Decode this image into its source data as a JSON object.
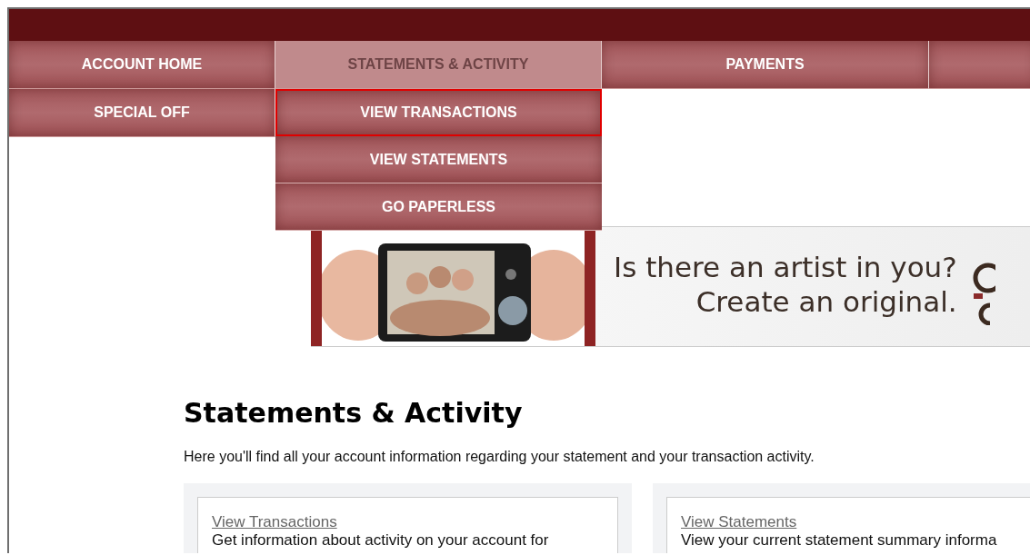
{
  "nav": {
    "tabs": [
      {
        "label": "ACCOUNT HOME",
        "selected": false
      },
      {
        "label": "STATEMENTS & ACTIVITY",
        "selected": true
      },
      {
        "label": "PAYMENTS",
        "selected": false
      },
      {
        "selected": false
      },
      {
        "label": "SPECIAL OFF",
        "selected": false
      }
    ]
  },
  "dropdown": {
    "items": [
      {
        "label": "VIEW TRANSACTIONS",
        "selected": true
      },
      {
        "label": "VIEW STATEMENTS",
        "selected": false
      },
      {
        "label": "GO PAPERLESS",
        "selected": false
      }
    ]
  },
  "banner": {
    "kind": "picture",
    "lines": [
      "Is there an artist in you?",
      "Create an original."
    ]
  },
  "page": {
    "heading": "Statements & Activity",
    "intro": "Here you'll find all your account information regarding your statement and your transaction activity.",
    "cards": [
      {
        "link": "View Transactions",
        "text": "Get information about activity on your account for"
      },
      {
        "link": "View Statements",
        "text": "View your current statement summary informa"
      }
    ]
  }
}
